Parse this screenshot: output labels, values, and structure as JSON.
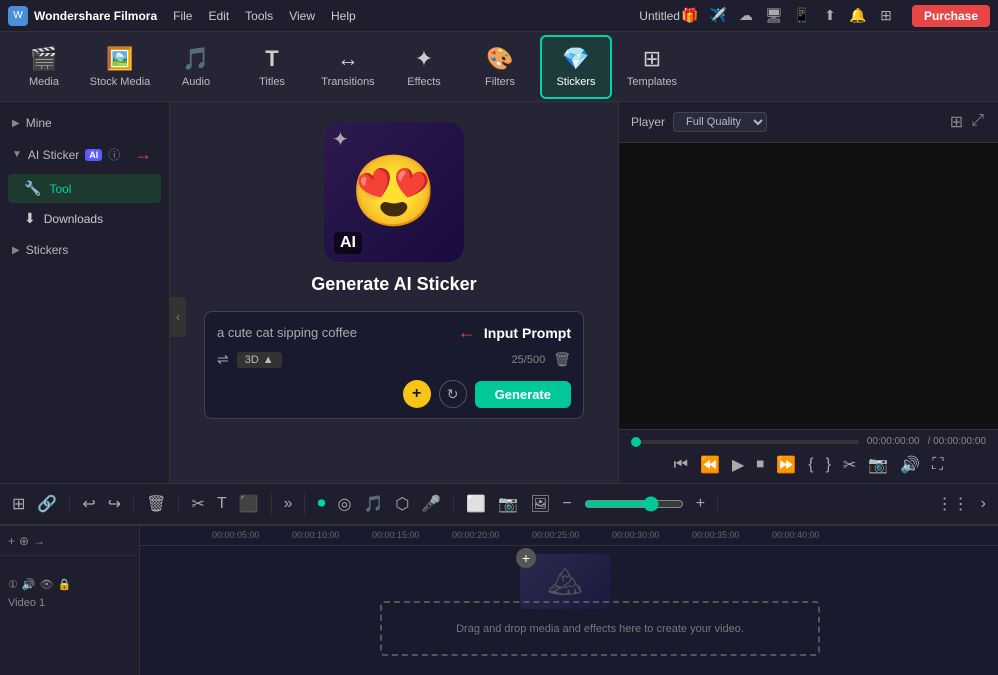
{
  "app": {
    "name": "Wondershare Filmora",
    "title": "Untitled",
    "purchase_label": "Purchase"
  },
  "menu": {
    "items": [
      "File",
      "Edit",
      "Tools",
      "View",
      "Help"
    ]
  },
  "toolbar": {
    "items": [
      {
        "id": "media",
        "label": "Media",
        "icon": "🎬"
      },
      {
        "id": "stock_media",
        "label": "Stock Media",
        "icon": "🖼️"
      },
      {
        "id": "audio",
        "label": "Audio",
        "icon": "🎵"
      },
      {
        "id": "titles",
        "label": "Titles",
        "icon": "T"
      },
      {
        "id": "transitions",
        "label": "Transitions",
        "icon": "⟐"
      },
      {
        "id": "effects",
        "label": "Effects",
        "icon": "✨"
      },
      {
        "id": "filters",
        "label": "Filters",
        "icon": "🎨"
      },
      {
        "id": "stickers",
        "label": "Stickers",
        "icon": "🔖"
      },
      {
        "id": "templates",
        "label": "Templates",
        "icon": "⊞"
      }
    ],
    "active": "stickers"
  },
  "sidebar": {
    "sections": [
      {
        "id": "mine",
        "label": "Mine",
        "expanded": false
      },
      {
        "id": "ai_sticker",
        "label": "AI Sticker",
        "badge": "AI",
        "expanded": true
      },
      {
        "id": "tool",
        "label": "Tool",
        "icon": "🔧",
        "active": true
      },
      {
        "id": "downloads",
        "label": "Downloads",
        "icon": "⬇"
      },
      {
        "id": "stickers",
        "label": "Stickers",
        "expanded": false
      }
    ]
  },
  "ai_sticker": {
    "title": "Generate AI Sticker",
    "prompt": "a cute cat sipping coffee",
    "prompt_placeholder": "a cute cat sipping coffee",
    "input_prompt_label": "Input Prompt",
    "style": "3D",
    "char_count": "25/500",
    "generate_label": "Generate"
  },
  "player": {
    "label": "Player",
    "quality": "Full Quality",
    "time_current": "00:00:00:00",
    "time_total": "/ 00:00:00:00"
  },
  "timeline": {
    "track_label": "Video 1",
    "ruler_marks": [
      "00:00:05:00",
      "00:00:10:00",
      "00:00:15:00",
      "00:00:20:00",
      "00:00:25:00",
      "00:00:30:00",
      "00:00:35:00",
      "00:00:40:00"
    ],
    "drop_text": "Drag and drop media and effects here to create your video."
  }
}
